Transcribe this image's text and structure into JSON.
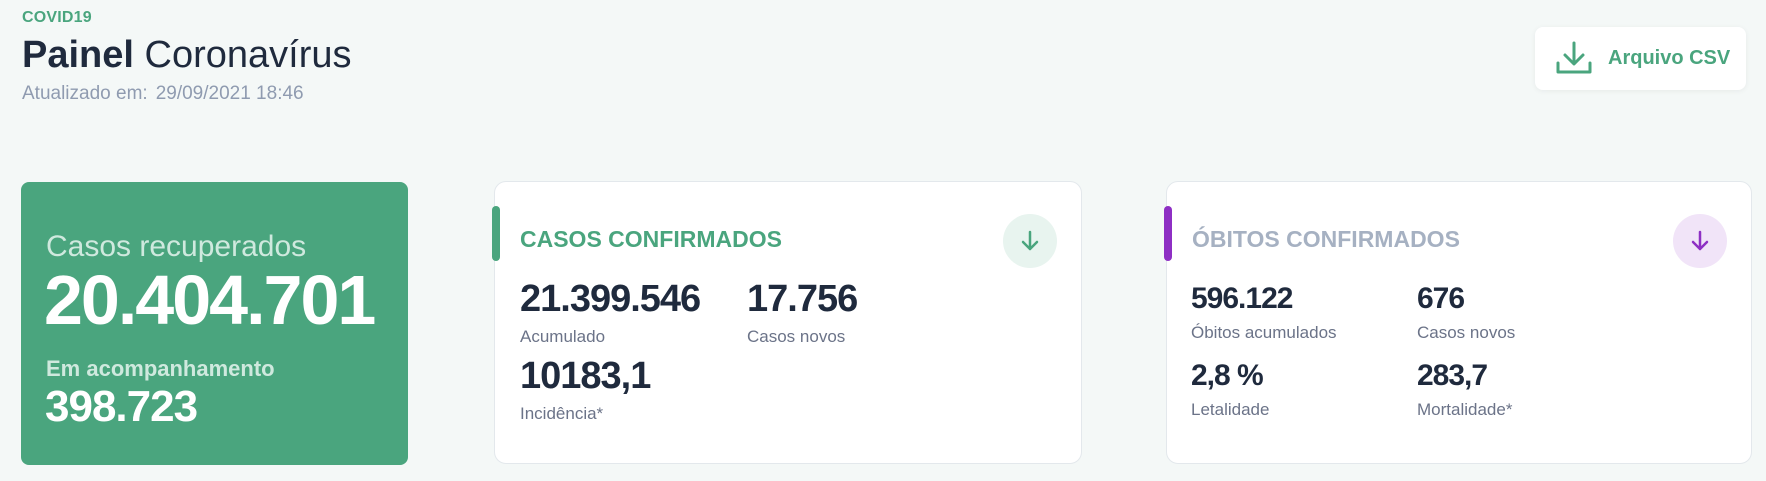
{
  "header": {
    "eyebrow": "COVID19",
    "title_bold": "Painel",
    "title_rest": "Coronavírus",
    "updated_label": "Atualizado em:",
    "updated_value": "29/09/2021 18:46"
  },
  "csv_button": {
    "label": "Arquivo CSV",
    "icon": "download-icon"
  },
  "recovered": {
    "label": "Casos recuperados",
    "value": "20.404.701",
    "followup_label": "Em acompanhamento",
    "followup_value": "398.723"
  },
  "confirmed_cases": {
    "title": "CASOS CONFIRMADOS",
    "accent": "#4aa57e",
    "icon": "arrow-down-icon",
    "stats": [
      {
        "value": "21.399.546",
        "label": "Acumulado"
      },
      {
        "value": "17.756",
        "label": "Casos novos"
      },
      {
        "value": "10183,1",
        "label": "Incidência*"
      }
    ]
  },
  "confirmed_deaths": {
    "title": "ÓBITOS CONFIRMADOS",
    "accent": "#8e2fc4",
    "icon": "arrow-down-icon",
    "stats": [
      {
        "value": "596.122",
        "label": "Óbitos acumulados"
      },
      {
        "value": "676",
        "label": "Casos novos"
      },
      {
        "value": "2,8 %",
        "label": "Letalidade"
      },
      {
        "value": "283,7",
        "label": "Mortalidade*"
      }
    ]
  },
  "colors": {
    "background": "#f4f8f7",
    "green": "#4aa57e",
    "purple": "#8e2fc4",
    "text_dark": "#1f2a3d",
    "text_muted": "#8f9bb0"
  }
}
